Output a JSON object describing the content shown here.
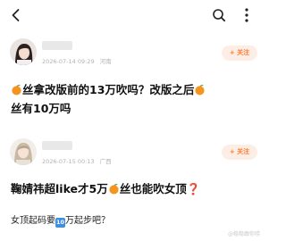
{
  "header": {
    "icons": [
      "back-icon",
      "search-icon",
      "more-icon"
    ]
  },
  "posts": [
    {
      "timestamp": "2026-07-14 09:29",
      "location": "河南",
      "follow_label": "+ 关注",
      "title_parts": [
        "丝拿改版前的13万吹吗？改版之后",
        "丝有10万吗"
      ]
    },
    {
      "timestamp": "2026-07-15 00:13",
      "location": "广西",
      "follow_label": "+ 关注",
      "title_parts": [
        "鞠婧祎超like才5",
        "万",
        "丝也能吹女顶",
        "❓"
      ],
      "subtitle_parts": [
        "女顶起码要",
        "10",
        "万起步吧？"
      ]
    }
  ],
  "watermark": "@稳稳跟你唠",
  "colors": {
    "accent": "#ff7a2f",
    "follow_bg": "#fdeee5",
    "meta_text": "#b3b3b3",
    "question_red": "#e23b2e",
    "keycap_blue": "#3d8fe0"
  }
}
